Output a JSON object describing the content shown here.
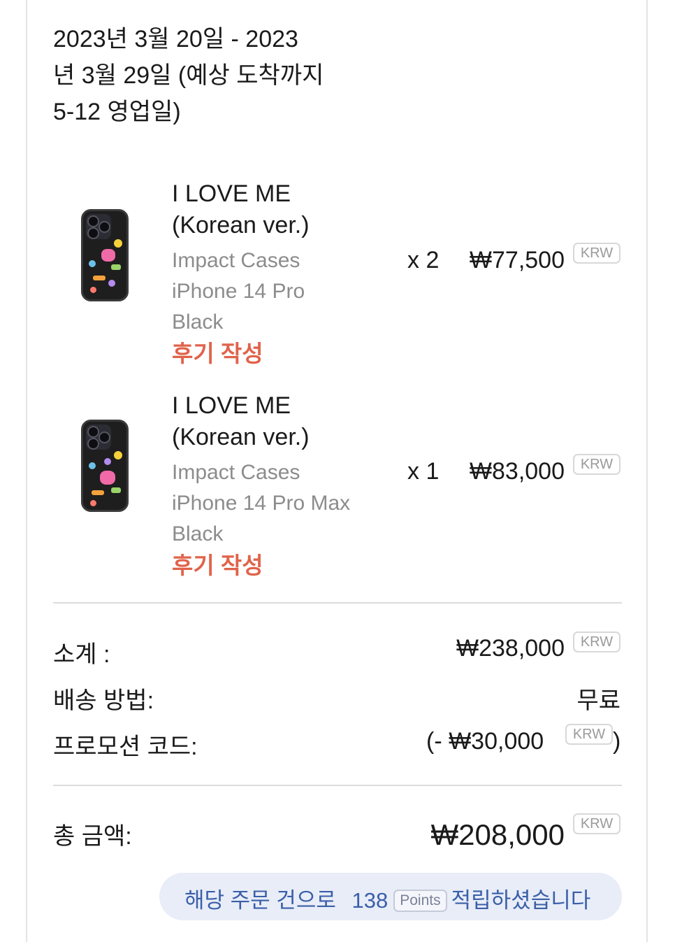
{
  "delivery": {
    "line1": "2023년 3월 20일 - 2023",
    "line2": "년 3월 29일 (예상 도착까지",
    "line3": "5-12 영업일)"
  },
  "items": [
    {
      "title_line1": "I LOVE ME",
      "title_line2": "(Korean ver.)",
      "variant_line1": "Impact Cases",
      "variant_line2": "iPhone 14 Pro",
      "variant_line3": "Black",
      "review_label": "후기 작성",
      "qty": "x 2",
      "price": "₩77,500",
      "currency": "KRW"
    },
    {
      "title_line1": "I LOVE ME",
      "title_line2": "(Korean ver.)",
      "variant_line1": "Impact Cases",
      "variant_line2": "iPhone 14 Pro Max",
      "variant_line3": "Black",
      "review_label": "후기 작성",
      "qty": "x 1",
      "price": "₩83,000",
      "currency": "KRW"
    }
  ],
  "summary": {
    "subtotal_label": "소계 :",
    "subtotal_value": "₩238,000",
    "subtotal_currency": "KRW",
    "shipping_label": "배송 방법:",
    "shipping_value": "무료",
    "promo_label": "프로모션 코드:",
    "promo_prefix": "(- ",
    "promo_value": "₩30,000",
    "promo_currency": "KRW",
    "promo_suffix": ")",
    "total_label": "총 금액:",
    "total_value": "₩208,000",
    "total_currency": "KRW"
  },
  "points": {
    "prefix": "해당 주문 건으로",
    "amount": "138",
    "unit": "Points",
    "suffix": "적립하셨습니다"
  },
  "colors": {
    "review": "#e0634b",
    "points_text": "#3b5fa8",
    "points_bg": "#e8edf8",
    "variant_text": "#8c8c8c"
  },
  "icons": [
    "phone-case-thumbnail"
  ]
}
